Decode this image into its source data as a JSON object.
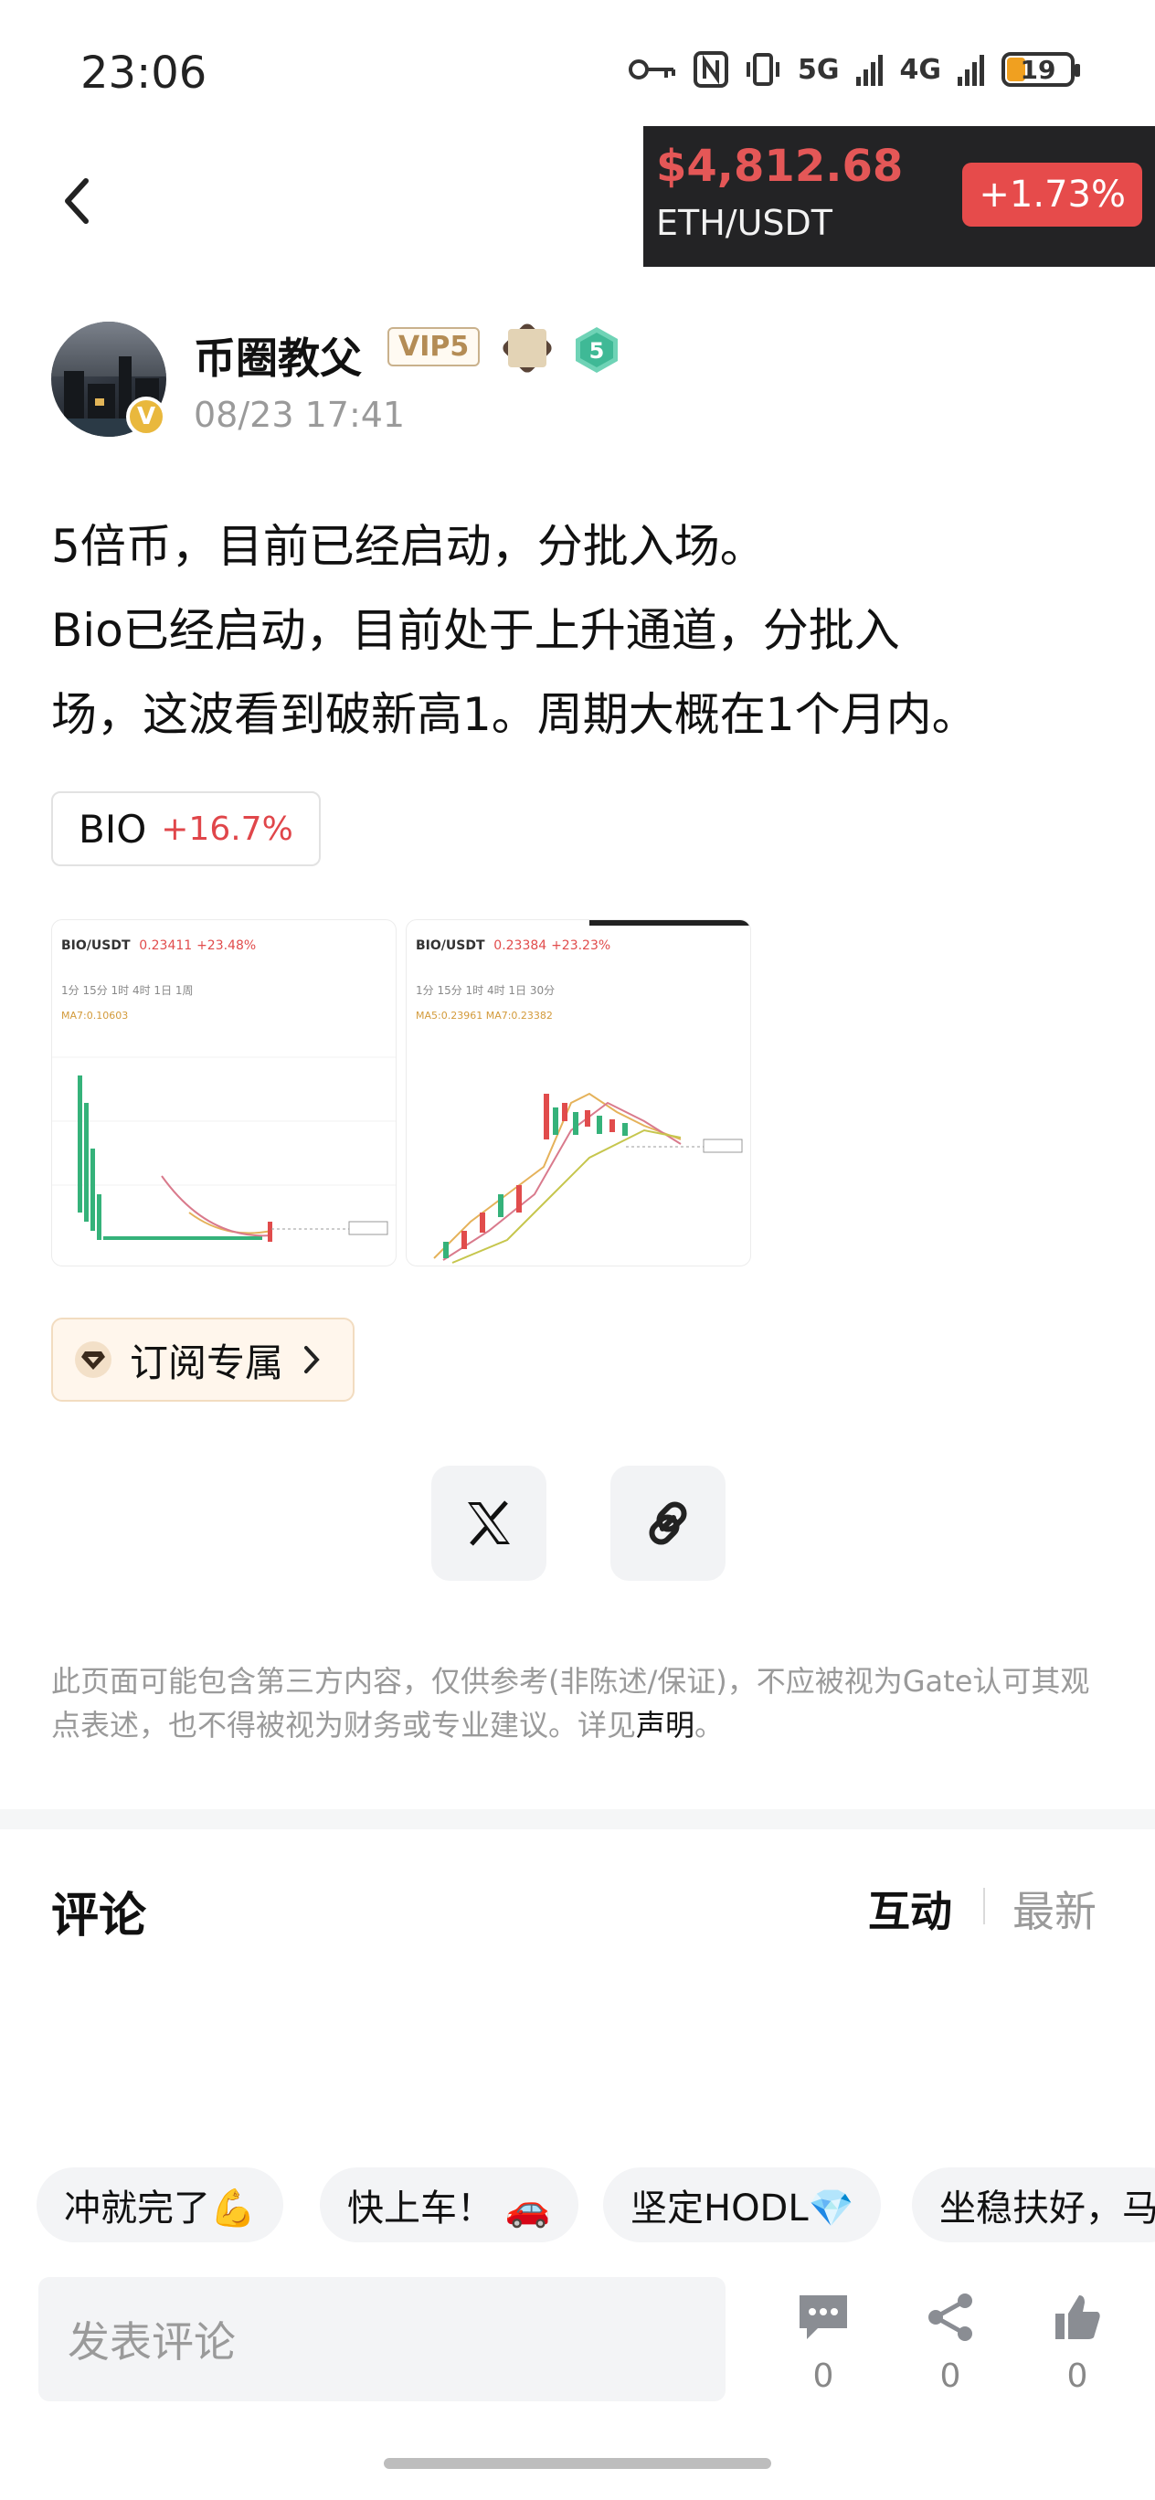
{
  "status_bar": {
    "time": "23:06",
    "network1": "5G",
    "network2": "4G",
    "battery": "19"
  },
  "ticker": {
    "price": "$4,812.68",
    "pair": "ETH/USDT",
    "change": "+1.73%"
  },
  "author": {
    "name": "币圈教父",
    "vip": "VIP5",
    "level": "5",
    "verified": "V",
    "time": "08/23 17:41"
  },
  "post": {
    "line1": "5倍币，目前已经启动，分批入场。",
    "line2": "Bio已经启动，目前处于上升通道，分批入",
    "line3": "场，这波看到破新高1。周期大概在1个月内。",
    "coin_symbol": "BIO",
    "coin_change": "+16.7%"
  },
  "thumbnails": [
    {
      "pair": "BIO/USDT",
      "price": "0.23411",
      "change": "+23.48%",
      "intervals": "1分  15分  1时  4时  1日  1周",
      "ma": "MA7:0.10603"
    },
    {
      "pair": "BIO/USDT",
      "price": "0.23384",
      "change": "+23.23%",
      "intervals": "1分  15分  1时  4时  1日  30分",
      "ma": "MA5:0.23961  MA7:0.23382"
    }
  ],
  "subscribe_label": "订阅专属",
  "disclaimer": {
    "text": "此页面可能包含第三方内容，仅供参考(非陈述/保证)，不应被视为Gate认可其观点表述，也不得被视为财务或专业建议。详见",
    "link": "声明",
    "end": "。"
  },
  "comments": {
    "title": "评论",
    "tab_hot": "互动",
    "tab_new": "最新"
  },
  "quick_replies": [
    "冲就完了💪",
    "快上车！ 🚗",
    "坚定HODL💎",
    "坐稳扶好，马"
  ],
  "bottom": {
    "input_placeholder": "发表评论",
    "comment_count": "0",
    "share_count": "0",
    "like_count": "0"
  },
  "colors": {
    "price_red": "#e45757",
    "change_bg": "#e64b4b",
    "coin_change": "#e0464a"
  }
}
